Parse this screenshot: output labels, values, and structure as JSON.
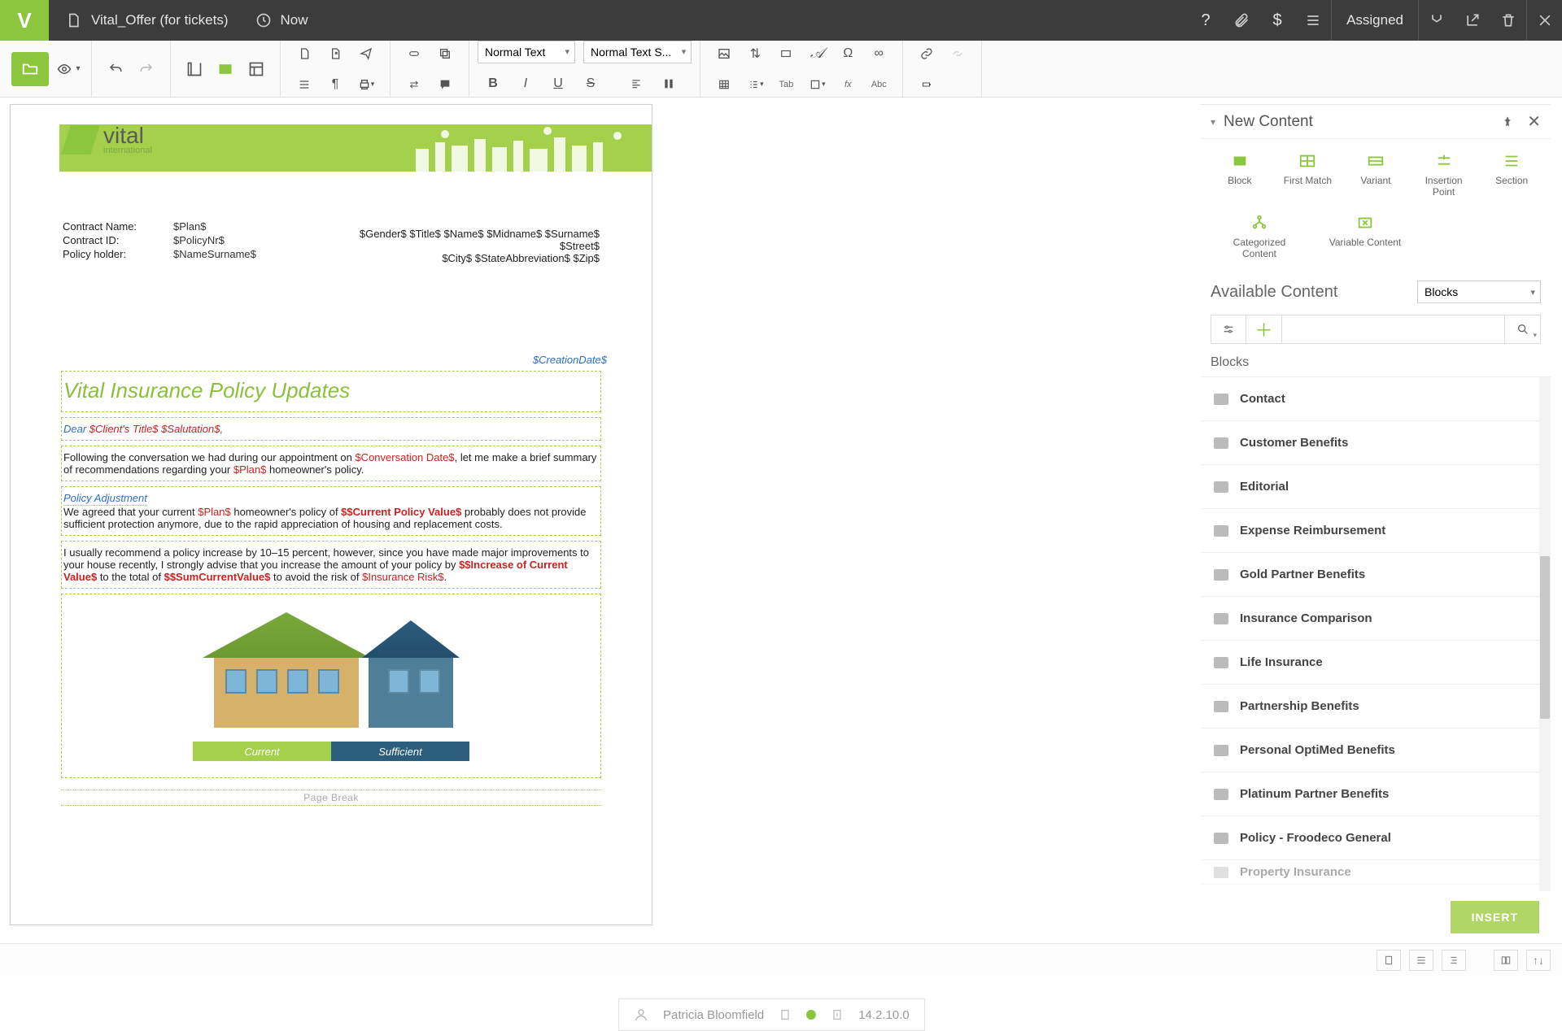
{
  "app": {
    "doc_name": "Vital_Offer  (for tickets)",
    "now_label": "Now",
    "assigned_label": "Assigned"
  },
  "ribbon": {
    "style_sel": "Normal Text",
    "font_sel": "Normal Text S...",
    "tab_label": "Tab",
    "fx_label": "fx",
    "abc_label": "Abc"
  },
  "document": {
    "brand_main": "vital",
    "brand_sub": "international",
    "meta": {
      "contract_name_k": "Contract Name:",
      "contract_name_v": "$Plan$",
      "contract_id_k": "Contract ID:",
      "contract_id_v": "$PolicyNr$",
      "policy_holder_k": "Policy holder:",
      "policy_holder_v": "$NameSurname$"
    },
    "address": {
      "line1": "$Gender$ $Title$ $Name$ $Midname$ $Surname$",
      "line2": "$Street$",
      "line3": "$City$ $StateAbbreviation$ $Zip$"
    },
    "creation_date": "$CreationDate$",
    "title": "Vital Insurance Policy Updates",
    "salutation_prefix": "Dear ",
    "salutation_var1": "$Client's Title$",
    "salutation_var2": "$Salutation$",
    "salutation_suffix": ",",
    "para1a": "Following the conversation we had during our appointment on ",
    "para1_var": "$Conversation Date$",
    "para1b": ", let me make a brief summary of recommendations regarding your ",
    "para1_var2": "$Plan$",
    "para1c": " homeowner's policy.",
    "sub1": "Policy Adjustment",
    "para2a": "We agreed that your current ",
    "para2_var1": "$Plan$",
    "para2b": " homeowner's policy of ",
    "para2_var2": "$$Current Policy Value$",
    "para2c": " probably does not provide sufficient protection anymore, due to the rapid appreciation of housing and replacement costs.",
    "para3a": "I usually recommend a policy increase by 10–15 percent, however, since you have made major improvements to your house recently, I strongly advise that you increase the amount of your policy by ",
    "para3_var1": "$$Increase of Current Value$",
    "para3b": " to the total of ",
    "para3_var2": "$$SumCurrentValue$",
    "para3c": " to avoid the risk of ",
    "para3_var3": "$Insurance Risk$",
    "para3d": ".",
    "bar_current": "Current",
    "bar_sufficient": "Sufficient",
    "page_break": "Page Break"
  },
  "user_float": {
    "name": "Patricia Bloomfield",
    "version": "14.2.10.0"
  },
  "panel": {
    "title": "New Content",
    "types": {
      "block": "Block",
      "first_match": "First Match",
      "variant": "Variant",
      "insertion_point": "Insertion Point",
      "section": "Section",
      "categorized": "Categorized Content",
      "variable": "Variable Content"
    },
    "available_title": "Available Content",
    "available_sel": "Blocks",
    "list_header": "Blocks",
    "items": [
      "Contact",
      "Customer Benefits",
      "Editorial",
      "Expense Reimbursement",
      "Gold Partner Benefits",
      "Insurance Comparison",
      "Life Insurance",
      "Partnership Benefits",
      "Personal OptiMed Benefits",
      "Platinum Partner Benefits",
      "Policy - Froodeco General",
      "Property Insurance"
    ],
    "insert_btn": "INSERT"
  }
}
